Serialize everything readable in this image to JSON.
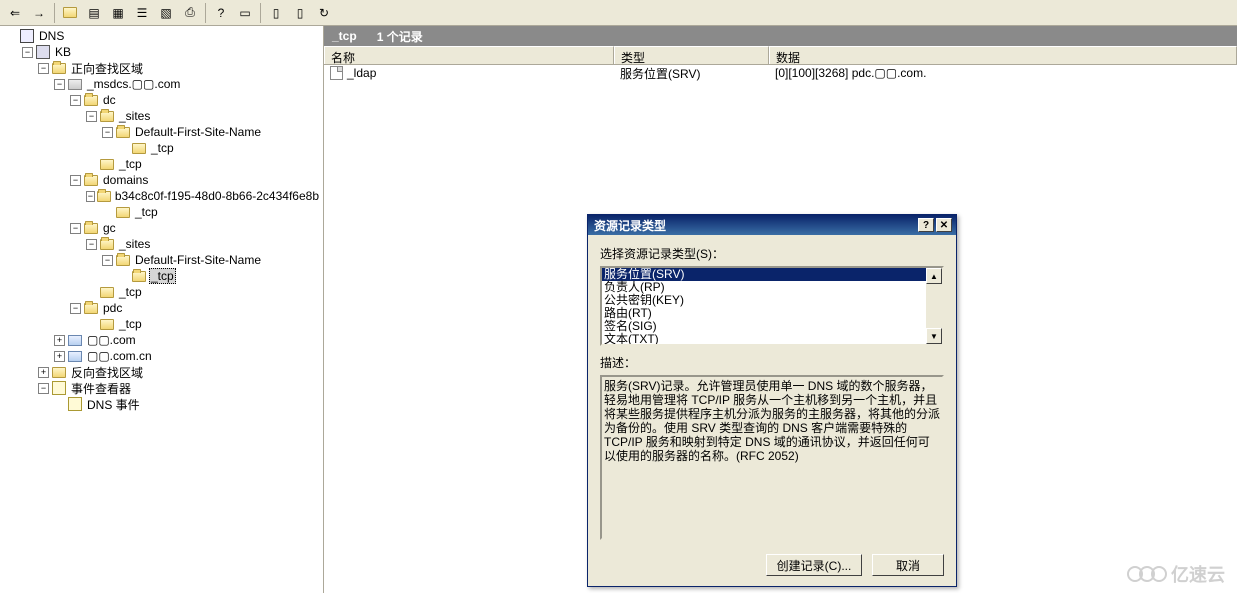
{
  "toolbar": {
    "icons": [
      "back",
      "forward",
      "up",
      "view-list",
      "view-detail",
      "properties",
      "properties2",
      "export",
      "help",
      "db",
      "doc",
      "doc2",
      "refresh"
    ]
  },
  "tree": {
    "root": "DNS",
    "server": "KB",
    "fwd_zone": "正向查找区域",
    "zone_msdcs": "_msdcs.▢▢.com",
    "dc": "dc",
    "sites": "_sites",
    "default_site": "Default-First-Site-Name",
    "tcp": "_tcp",
    "domains": "domains",
    "guid_domain": "b34c8c0f-f195-48d0-8b66-2c434f6e8b",
    "gc": "gc",
    "pdc": "pdc",
    "zone_com": "▢▢.com",
    "zone_comcn": "▢▢.com.cn",
    "rev_zone": "反向查找区域",
    "event_viewer": "事件查看器",
    "dns_event": "DNS 事件"
  },
  "right": {
    "header_path": "_tcp",
    "header_count": "1 个记录",
    "cols": {
      "name": "名称",
      "type": "类型",
      "data": "数据"
    },
    "rows": [
      {
        "name": "_ldap",
        "type": "服务位置(SRV)",
        "data": "[0][100][3268] pdc.▢▢.com."
      }
    ]
  },
  "dialog": {
    "title": "资源记录类型",
    "select_label": "选择资源记录类型(S)：",
    "items": [
      "服务位置(SRV)",
      "负责人(RP)",
      "公共密钥(KEY)",
      "路由(RT)",
      "签名(SIG)",
      "文本(TXT)"
    ],
    "desc_label": "描述：",
    "desc_text": "服务(SRV)记录。允许管理员使用单一 DNS 域的数个服务器，轻易地用管理将 TCP/IP 服务从一个主机移到另一个主机，并且将某些服务提供程序主机分派为服务的主服务器，将其他的分派为备份的。使用 SRV 类型查询的 DNS 客户端需要特殊的 TCP/IP 服务和映射到特定 DNS 域的通讯协议，并返回任何可以使用的服务器的名称。(RFC 2052)",
    "btn_create": "创建记录(C)...",
    "btn_cancel": "取消"
  },
  "watermark": "亿速云"
}
